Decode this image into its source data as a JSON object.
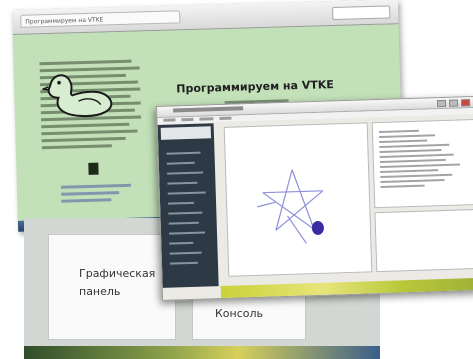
{
  "back_window": {
    "heading": "Программируем на VTKE",
    "tab_title": "Программируем на VTKE"
  },
  "middle_window": {
    "slide_left_text_line1": "Графическая",
    "slide_left_text_line2": "панель",
    "slide_right_text": "Консоль"
  },
  "front_window": {
    "canvas_drawing": "star-turtle-drawing"
  },
  "colors": {
    "page_background": "#c3e1b9",
    "ide_sidebar": "#2d3a45",
    "star_stroke": "#8e8fd8",
    "turtle_fill": "#3b2aa5"
  }
}
